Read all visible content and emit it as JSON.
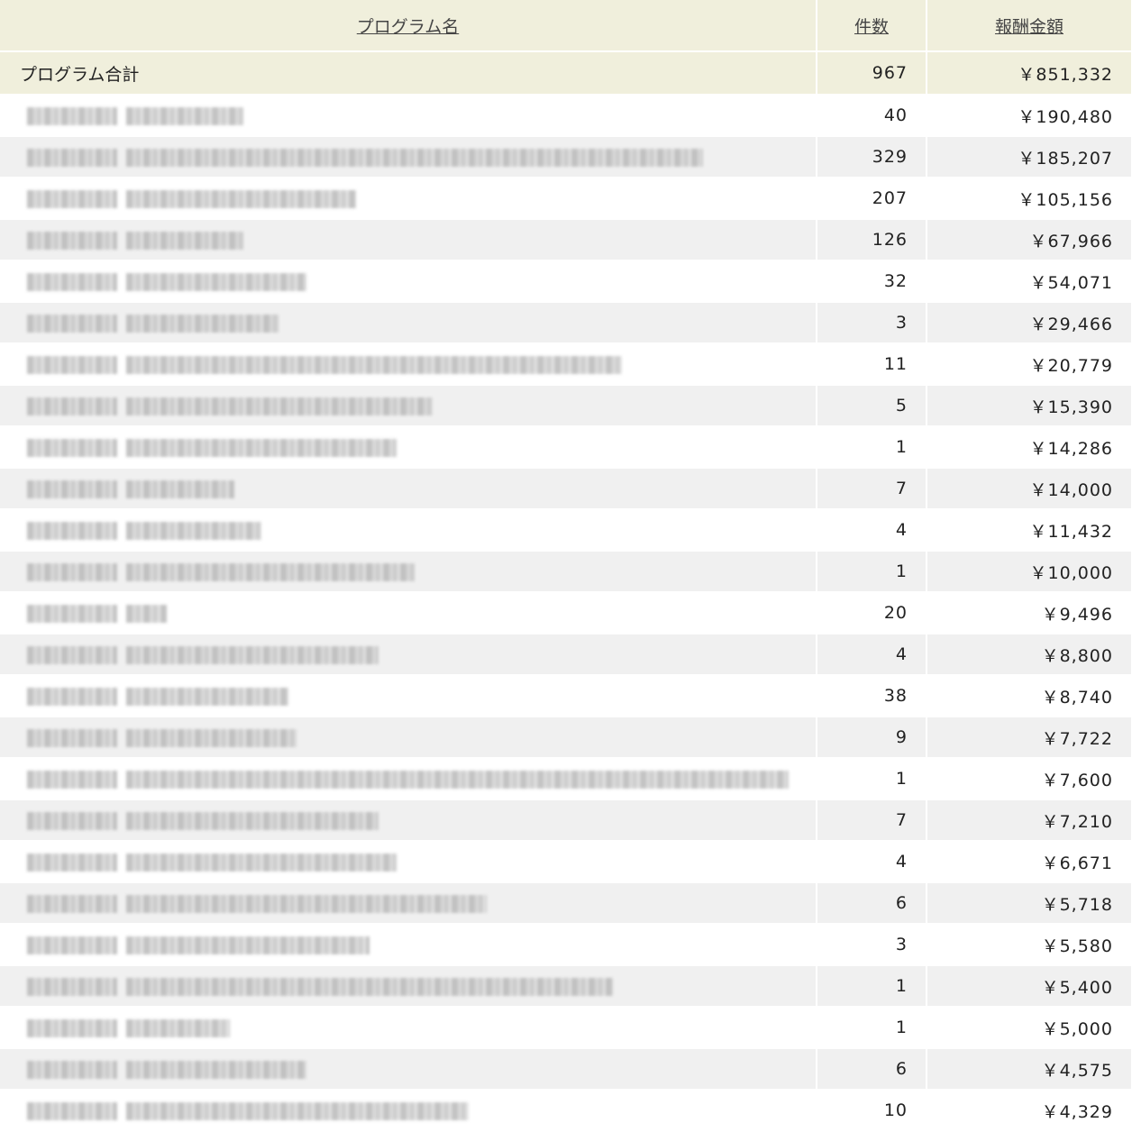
{
  "header": {
    "col_name": "プログラム名",
    "col_count": "件数",
    "col_amount": "報酬金額"
  },
  "total": {
    "label": "プログラム合計",
    "count": "967",
    "amount": "￥851,332"
  },
  "rows": [
    {
      "count": "40",
      "amount": "￥190,480",
      "name_width": 130
    },
    {
      "count": "329",
      "amount": "￥185,207",
      "name_width": 640
    },
    {
      "count": "207",
      "amount": "￥105,156",
      "name_width": 255
    },
    {
      "count": "126",
      "amount": "￥67,966",
      "name_width": 130
    },
    {
      "count": "32",
      "amount": "￥54,071",
      "name_width": 200
    },
    {
      "count": "3",
      "amount": "￥29,466",
      "name_width": 170
    },
    {
      "count": "11",
      "amount": "￥20,779",
      "name_width": 550
    },
    {
      "count": "5",
      "amount": "￥15,390",
      "name_width": 340
    },
    {
      "count": "1",
      "amount": "￥14,286",
      "name_width": 300
    },
    {
      "count": "7",
      "amount": "￥14,000",
      "name_width": 120
    },
    {
      "count": "4",
      "amount": "￥11,432",
      "name_width": 150
    },
    {
      "count": "1",
      "amount": "￥10,000",
      "name_width": 320
    },
    {
      "count": "20",
      "amount": "￥9,496",
      "name_width": 45
    },
    {
      "count": "4",
      "amount": "￥8,800",
      "name_width": 280
    },
    {
      "count": "38",
      "amount": "￥8,740",
      "name_width": 180
    },
    {
      "count": "9",
      "amount": "￥7,722",
      "name_width": 190
    },
    {
      "count": "1",
      "amount": "￥7,600",
      "name_width": 735
    },
    {
      "count": "7",
      "amount": "￥7,210",
      "name_width": 280
    },
    {
      "count": "4",
      "amount": "￥6,671",
      "name_width": 300
    },
    {
      "count": "6",
      "amount": "￥5,718",
      "name_width": 400
    },
    {
      "count": "3",
      "amount": "￥5,580",
      "name_width": 270
    },
    {
      "count": "1",
      "amount": "￥5,400",
      "name_width": 540
    },
    {
      "count": "1",
      "amount": "￥5,000",
      "name_width": 115
    },
    {
      "count": "6",
      "amount": "￥4,575",
      "name_width": 200
    },
    {
      "count": "10",
      "amount": "￥4,329",
      "name_width": 380
    }
  ]
}
